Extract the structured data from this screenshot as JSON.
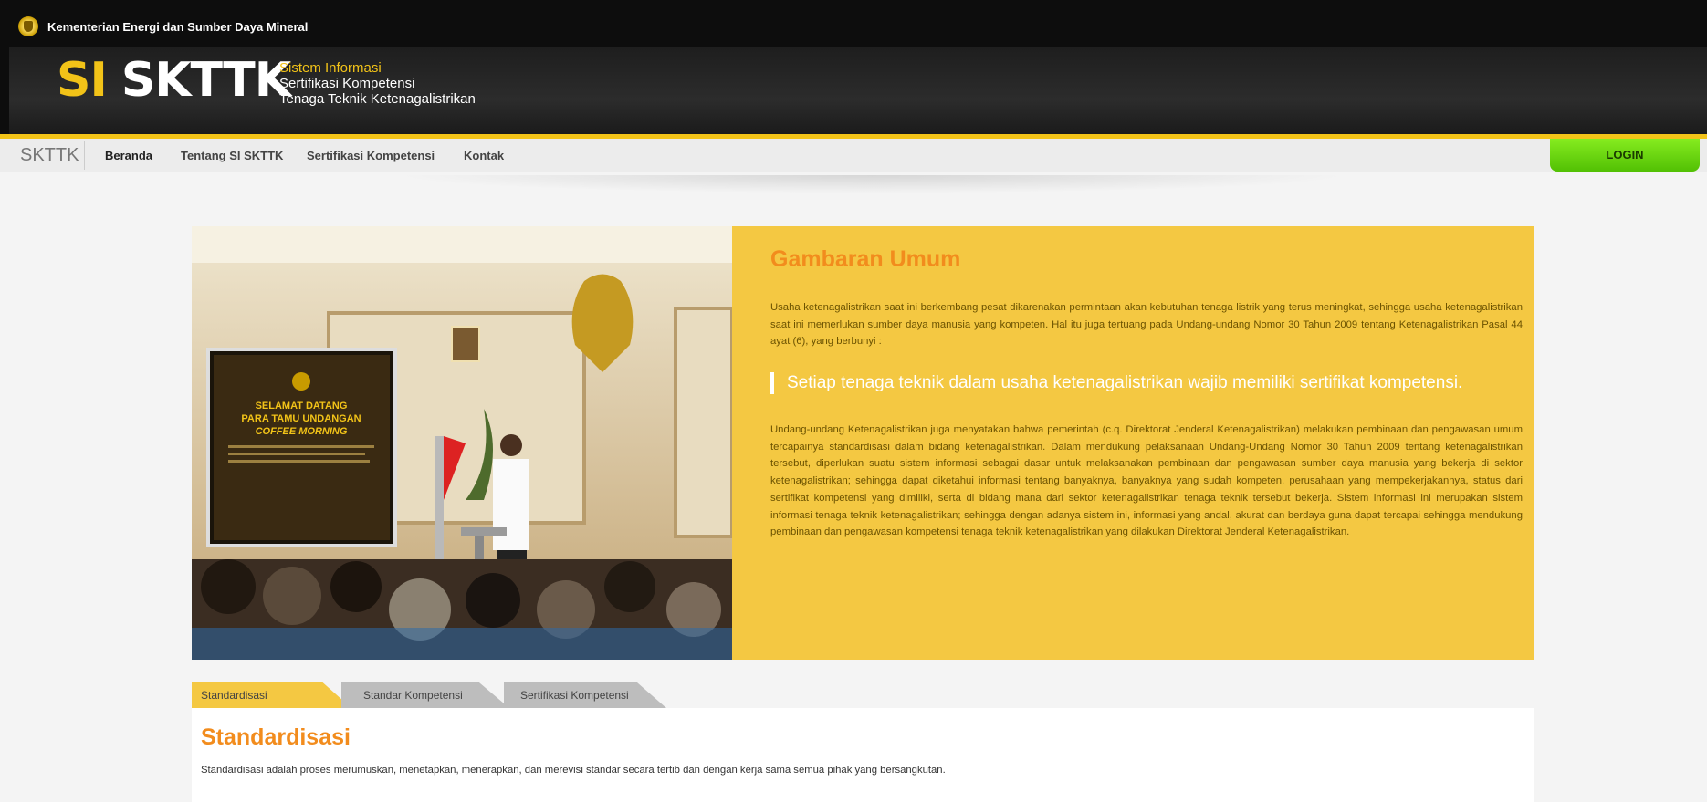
{
  "header": {
    "ministry": "Kementerian Energi dan Sumber Daya Mineral",
    "logo_si": "SI",
    "logo_skttk": "SKTTK",
    "tagline": [
      "Sistem Informasi",
      "Sertifikasi Kompetensi",
      "Tenaga Teknik Ketenagalistrikan"
    ]
  },
  "nav": {
    "brand": "SKTTK",
    "items": [
      "Beranda",
      "Tentang SI SKTTK",
      "Sertifikasi Kompetensi",
      "Kontak"
    ],
    "active": "Beranda",
    "login": "LOGIN"
  },
  "hero": {
    "slide_title": "SELAMAT DATANG",
    "slide_sub1": "PARA TAMU UNDANGAN",
    "slide_sub2": "COFFEE MORNING",
    "title": "Gambaran Umum",
    "para1": "Usaha ketenagalistrikan saat ini berkembang pesat dikarenakan permintaan akan kebutuhan tenaga listrik yang terus meningkat, sehingga usaha ketenagalistrikan saat ini memerlukan sumber daya manusia yang kompeten. Hal itu juga tertuang pada Undang-undang Nomor 30 Tahun 2009 tentang Ketenagalistrikan Pasal 44 ayat (6), yang berbunyi :",
    "quote": "Setiap tenaga teknik dalam usaha ketenagalistrikan wajib memiliki sertifikat kompetensi.",
    "para2": "Undang-undang Ketenagalistrikan juga menyatakan bahwa pemerintah (c.q. Direktorat Jenderal Ketenagalistrikan) melakukan pembinaan dan pengawasan umum tercapainya standardisasi dalam bidang ketenagalistrikan. Dalam mendukung pelaksanaan Undang-Undang Nomor 30 Tahun 2009 tentang ketenagalistrikan tersebut, diperlukan suatu sistem informasi sebagai dasar untuk melaksanakan pembinaan dan pengawasan sumber daya manusia yang bekerja di sektor ketenagalistrikan; sehingga dapat diketahui informasi tentang banyaknya, banyaknya yang sudah kompeten, perusahaan yang mempekerjakannya, status dari sertifikat kompetensi yang dimiliki, serta di bidang mana dari sektor ketenagalistrikan tenaga teknik tersebut bekerja. Sistem informasi ini merupakan sistem informasi tenaga teknik ketenagalistrikan; sehingga dengan adanya sistem ini, informasi yang andal, akurat dan berdaya guna dapat tercapai sehingga mendukung pembinaan dan pengawasan kompetensi tenaga teknik ketenagalistrikan yang dilakukan Direktorat Jenderal Ketenagalistrikan."
  },
  "tabs": {
    "items": [
      "Standardisasi",
      "Standar Kompetensi",
      "Sertifikasi Kompetensi"
    ],
    "active": "Standardisasi"
  },
  "panel": {
    "title": "Standardisasi",
    "text": "Standardisasi adalah proses merumuskan, menetapkan, menerapkan, dan merevisi standar secara tertib dan dengan kerja sama semua pihak yang bersangkutan."
  },
  "colors": {
    "accent_yellow": "#f4c842",
    "title_orange": "#f28c1d",
    "login_green": "#6fd812",
    "header_black": "#0d0d0d"
  }
}
